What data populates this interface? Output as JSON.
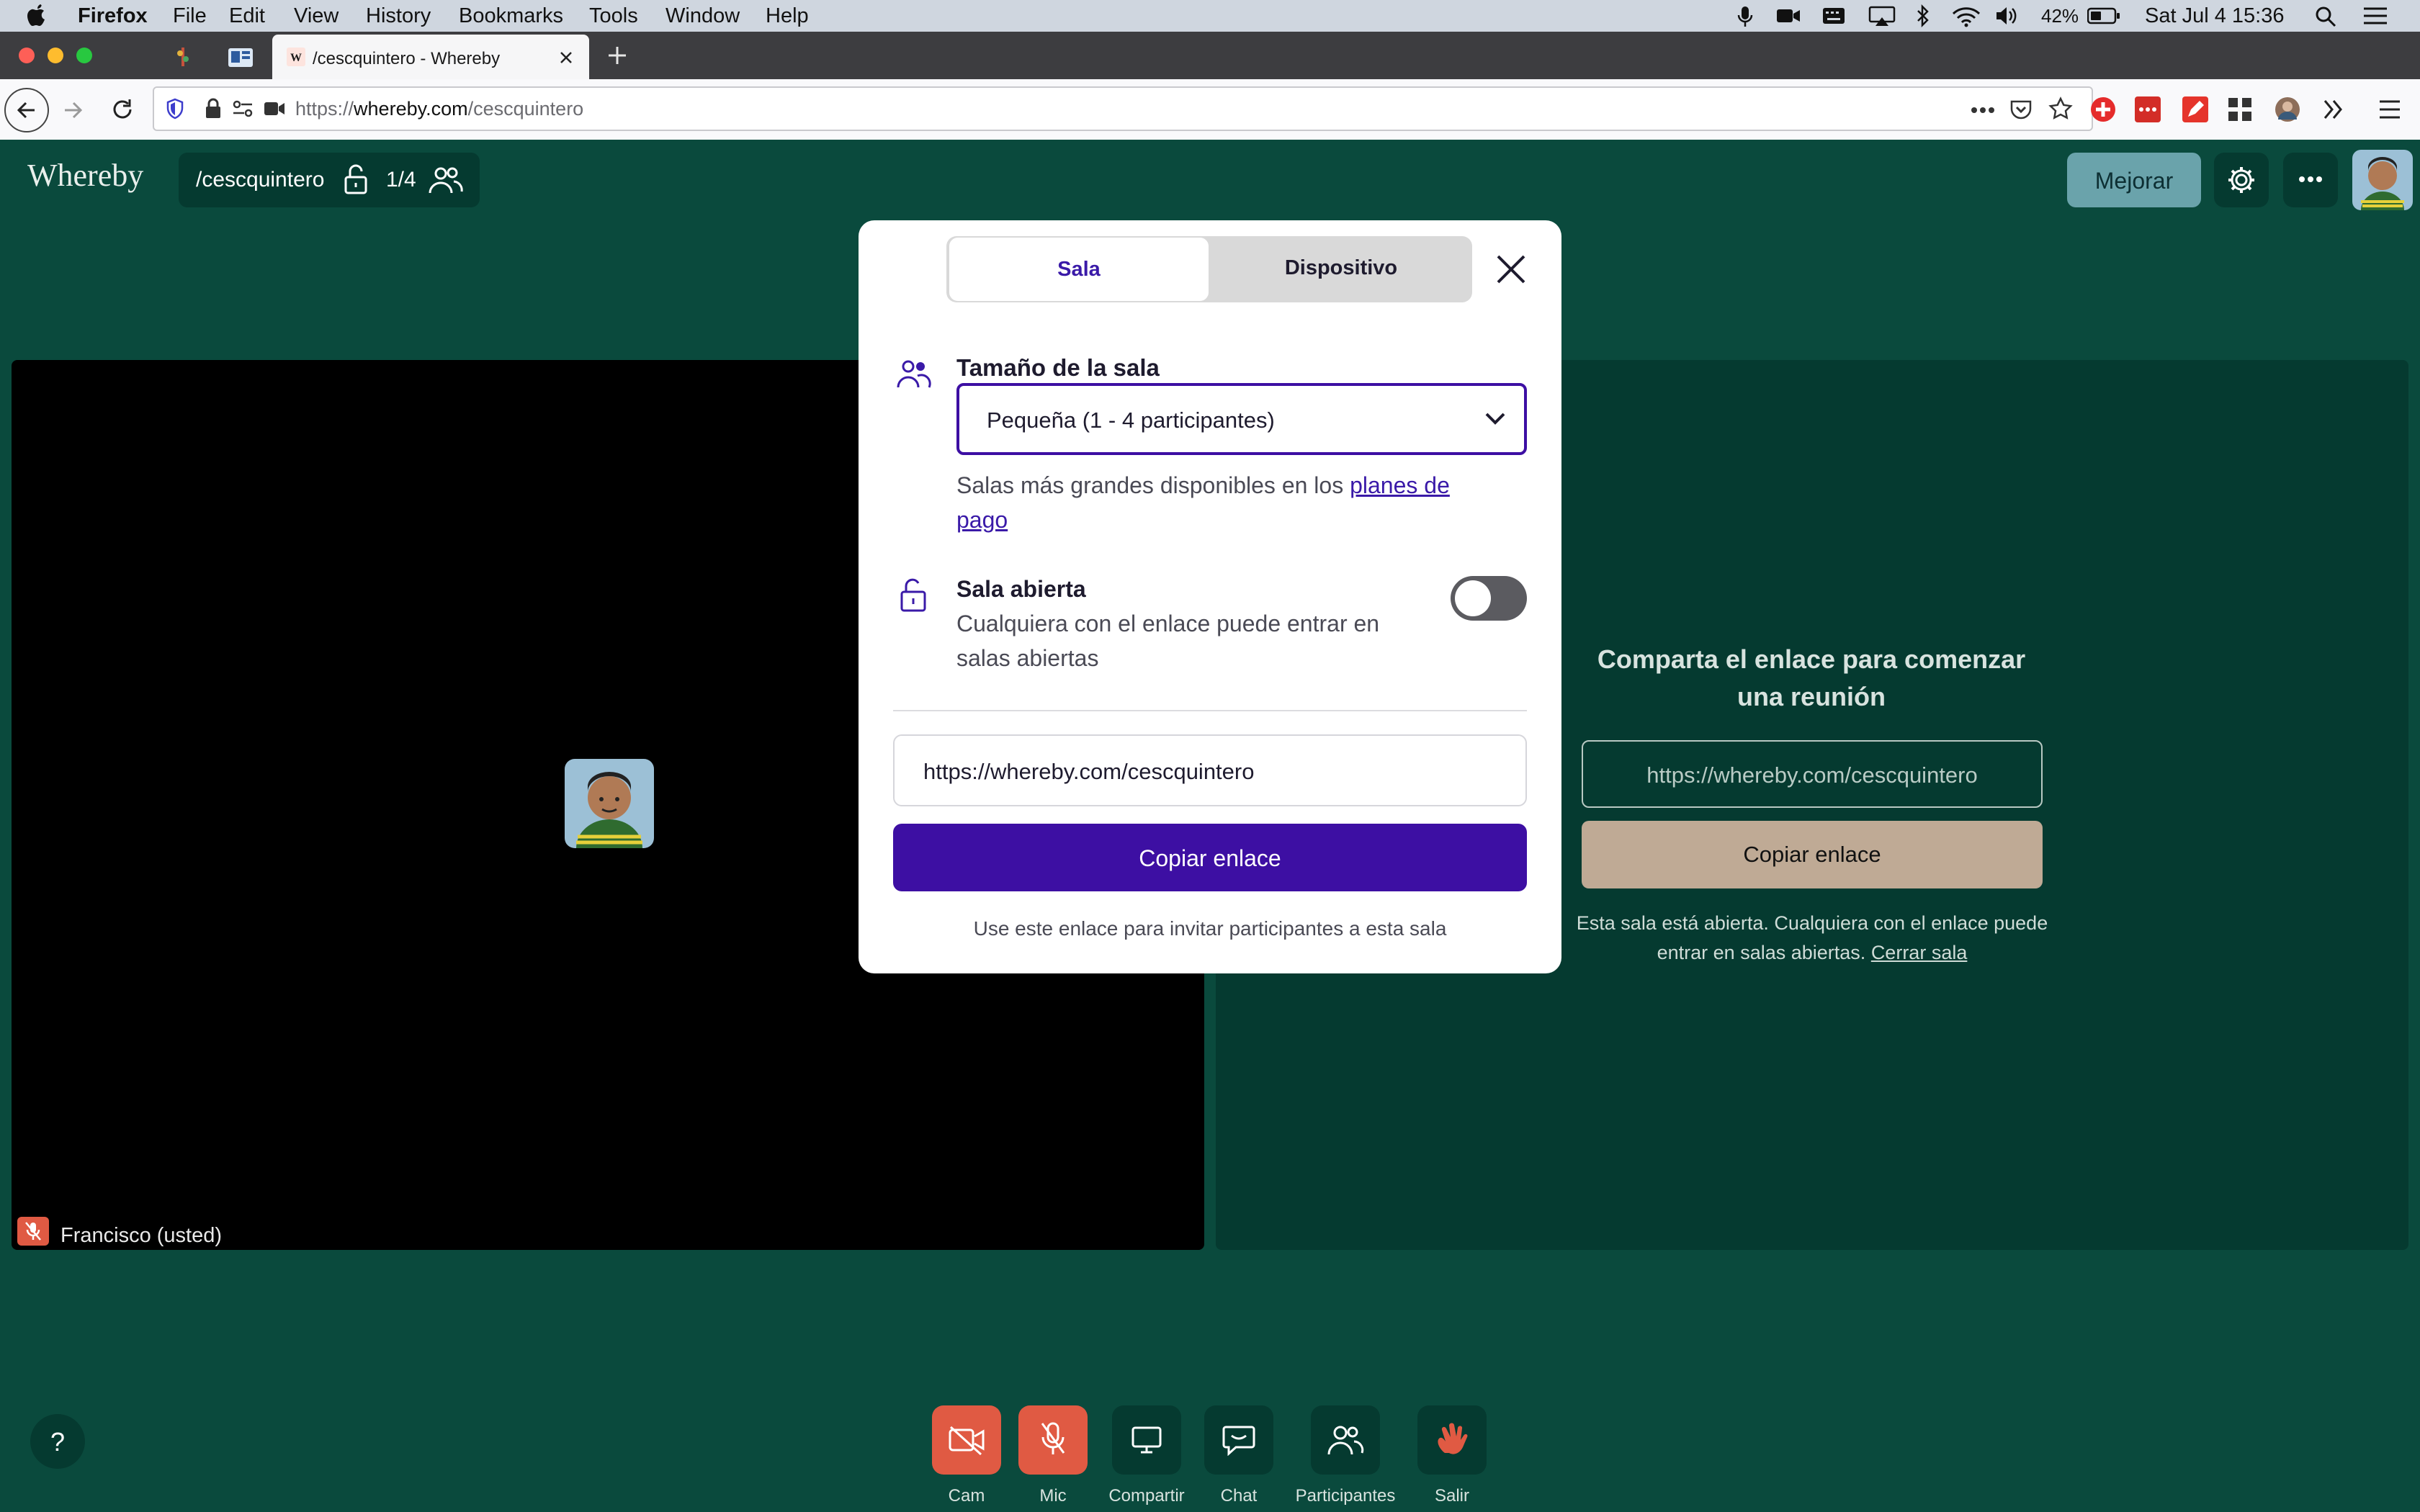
{
  "menubar": {
    "app": "Firefox",
    "items": [
      "File",
      "Edit",
      "View",
      "History",
      "Bookmarks",
      "Tools",
      "Window",
      "Help"
    ],
    "battery": "42%",
    "clock": "Sat Jul 4  15:36"
  },
  "browser": {
    "active_tab_title": "/cescquintero - Whereby",
    "url_prefix": "https://",
    "url_domain": "whereby.com",
    "url_path": "/cescquintero"
  },
  "app": {
    "logo": "Whereby",
    "room_name": "/cescquintero",
    "room_count": "1/4",
    "upgrade_label": "Mejorar",
    "self_name": "Francisco (usted)",
    "share_heading": "Comparta el enlace para comenzar una reunión",
    "share_url": "https://whereby.com/cescquintero",
    "share_copy_label": "Copiar enlace",
    "share_note": "Esta sala está abierta. Cualquiera con el enlace puede entrar en salas abiertas.",
    "share_close_link": "Cerrar sala",
    "help_label": "?",
    "controls": [
      {
        "label": "Cam"
      },
      {
        "label": "Mic"
      },
      {
        "label": "Compartir"
      },
      {
        "label": "Chat"
      },
      {
        "label": "Participantes"
      },
      {
        "label": "Salir"
      }
    ]
  },
  "modal": {
    "tab_room": "Sala",
    "tab_device": "Dispositivo",
    "size_heading": "Tamaño de la sala",
    "size_value": "Pequeña (1 - 4 participantes)",
    "size_note": "Salas más grandes disponibles en los ",
    "size_note_link": "planes de pago",
    "open_heading": "Sala abierta",
    "open_desc": "Cualquiera con el enlace puede entrar en salas abiertas",
    "open_toggle_on": false,
    "link_value": "https://whereby.com/cescquintero",
    "copy_label": "Copiar enlace",
    "footer": "Use este enlace para invitar participantes a esta sala"
  },
  "colors": {
    "app_bg": "#0a4a3d",
    "accent_purple": "#3d0fa3",
    "mute_red": "#e05a43",
    "upgrade_teal": "#6aa3ab"
  }
}
